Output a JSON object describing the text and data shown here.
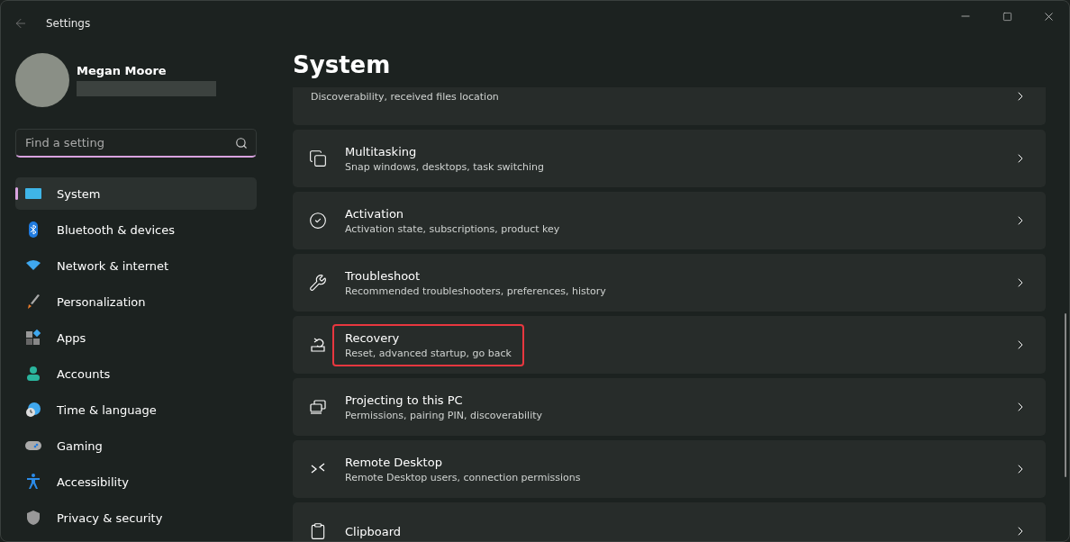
{
  "window": {
    "title": "Settings"
  },
  "profile": {
    "name": "Megan Moore"
  },
  "search": {
    "placeholder": "Find a setting"
  },
  "nav": [
    {
      "label": "System",
      "selected": true
    },
    {
      "label": "Bluetooth & devices",
      "selected": false
    },
    {
      "label": "Network & internet",
      "selected": false
    },
    {
      "label": "Personalization",
      "selected": false
    },
    {
      "label": "Apps",
      "selected": false
    },
    {
      "label": "Accounts",
      "selected": false
    },
    {
      "label": "Time & language",
      "selected": false
    },
    {
      "label": "Gaming",
      "selected": false
    },
    {
      "label": "Accessibility",
      "selected": false
    },
    {
      "label": "Privacy & security",
      "selected": false
    }
  ],
  "page": {
    "title": "System"
  },
  "cards": [
    {
      "subtitle": "Discoverability, received files location",
      "highlighted": false
    },
    {
      "title": "Multitasking",
      "subtitle": "Snap windows, desktops, task switching",
      "highlighted": false
    },
    {
      "title": "Activation",
      "subtitle": "Activation state, subscriptions, product key",
      "highlighted": false
    },
    {
      "title": "Troubleshoot",
      "subtitle": "Recommended troubleshooters, preferences, history",
      "highlighted": false
    },
    {
      "title": "Recovery",
      "subtitle": "Reset, advanced startup, go back",
      "highlighted": true
    },
    {
      "title": "Projecting to this PC",
      "subtitle": "Permissions, pairing PIN, discoverability",
      "highlighted": false
    },
    {
      "title": "Remote Desktop",
      "subtitle": "Remote Desktop users, connection permissions",
      "highlighted": false
    },
    {
      "title": "Clipboard",
      "highlighted": false
    }
  ]
}
